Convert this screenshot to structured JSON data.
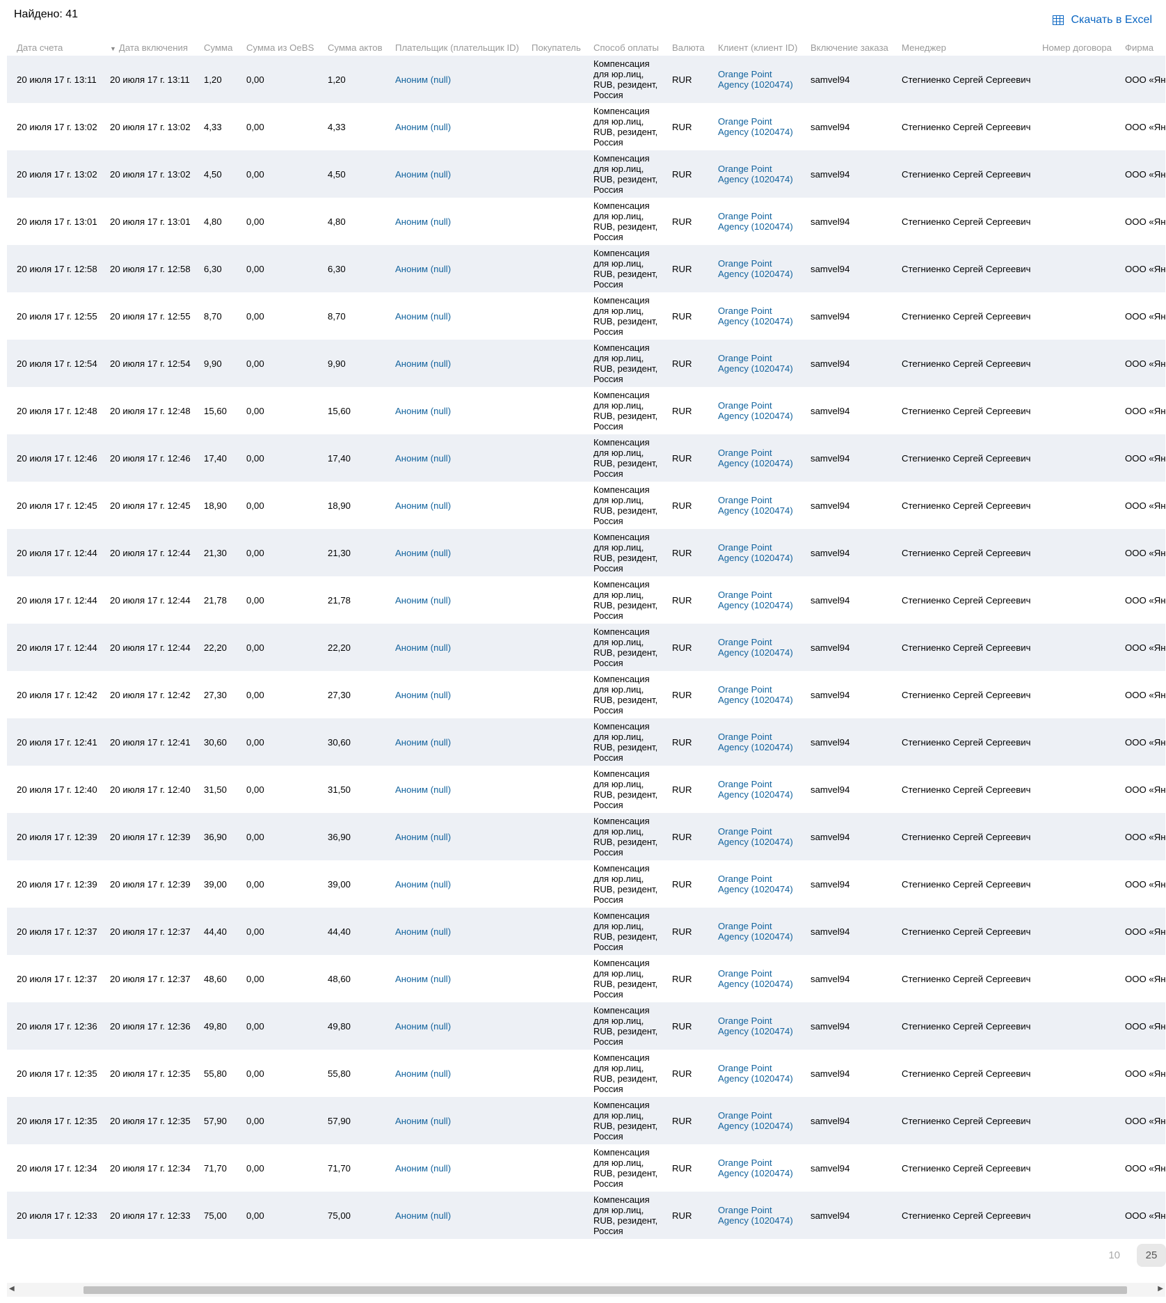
{
  "found_label": "Найдено: 41",
  "excel_label": "Скачать в Excel",
  "columns": [
    "Дата счета",
    "Дата включения",
    "Сумма",
    "Сумма из OeBS",
    "Сумма актов",
    "Плательщик (плательщик ID)",
    "Покупатель",
    "Способ оплаты",
    "Валюта",
    "Клиент (клиент ID)",
    "Включение заказа",
    "Менеджер",
    "Номер договора",
    "Фирма"
  ],
  "rows": [
    {
      "date": "20 июля 17 г. 13:11",
      "incl": "20 июля 17 г. 13:11",
      "sum": "1,20",
      "oebs": "0,00",
      "acts": "1,20",
      "payer": "Аноним (null)",
      "buyer": "",
      "method": "Компенсация для юр.лиц, RUB, резидент, Россия",
      "currency": "RUR",
      "client": "Orange Point Agency (1020474)",
      "order": "samvel94",
      "manager": "Стегниенко Сергей Сергеевич",
      "contract": "",
      "firm": "ООО «Ян"
    },
    {
      "date": "20 июля 17 г. 13:02",
      "incl": "20 июля 17 г. 13:02",
      "sum": "4,33",
      "oebs": "0,00",
      "acts": "4,33",
      "payer": "Аноним (null)",
      "buyer": "",
      "method": "Компенсация для юр.лиц, RUB, резидент, Россия",
      "currency": "RUR",
      "client": "Orange Point Agency (1020474)",
      "order": "samvel94",
      "manager": "Стегниенко Сергей Сергеевич",
      "contract": "",
      "firm": "ООО «Ян"
    },
    {
      "date": "20 июля 17 г. 13:02",
      "incl": "20 июля 17 г. 13:02",
      "sum": "4,50",
      "oebs": "0,00",
      "acts": "4,50",
      "payer": "Аноним (null)",
      "buyer": "",
      "method": "Компенсация для юр.лиц, RUB, резидент, Россия",
      "currency": "RUR",
      "client": "Orange Point Agency (1020474)",
      "order": "samvel94",
      "manager": "Стегниенко Сергей Сергеевич",
      "contract": "",
      "firm": "ООО «Ян"
    },
    {
      "date": "20 июля 17 г. 13:01",
      "incl": "20 июля 17 г. 13:01",
      "sum": "4,80",
      "oebs": "0,00",
      "acts": "4,80",
      "payer": "Аноним (null)",
      "buyer": "",
      "method": "Компенсация для юр.лиц, RUB, резидент, Россия",
      "currency": "RUR",
      "client": "Orange Point Agency (1020474)",
      "order": "samvel94",
      "manager": "Стегниенко Сергей Сергеевич",
      "contract": "",
      "firm": "ООО «Ян"
    },
    {
      "date": "20 июля 17 г. 12:58",
      "incl": "20 июля 17 г. 12:58",
      "sum": "6,30",
      "oebs": "0,00",
      "acts": "6,30",
      "payer": "Аноним (null)",
      "buyer": "",
      "method": "Компенсация для юр.лиц, RUB, резидент, Россия",
      "currency": "RUR",
      "client": "Orange Point Agency (1020474)",
      "order": "samvel94",
      "manager": "Стегниенко Сергей Сергеевич",
      "contract": "",
      "firm": "ООО «Ян"
    },
    {
      "date": "20 июля 17 г. 12:55",
      "incl": "20 июля 17 г. 12:55",
      "sum": "8,70",
      "oebs": "0,00",
      "acts": "8,70",
      "payer": "Аноним (null)",
      "buyer": "",
      "method": "Компенсация для юр.лиц, RUB, резидент, Россия",
      "currency": "RUR",
      "client": "Orange Point Agency (1020474)",
      "order": "samvel94",
      "manager": "Стегниенко Сергей Сергеевич",
      "contract": "",
      "firm": "ООО «Ян"
    },
    {
      "date": "20 июля 17 г. 12:54",
      "incl": "20 июля 17 г. 12:54",
      "sum": "9,90",
      "oebs": "0,00",
      "acts": "9,90",
      "payer": "Аноним (null)",
      "buyer": "",
      "method": "Компенсация для юр.лиц, RUB, резидент, Россия",
      "currency": "RUR",
      "client": "Orange Point Agency (1020474)",
      "order": "samvel94",
      "manager": "Стегниенко Сергей Сергеевич",
      "contract": "",
      "firm": "ООО «Ян"
    },
    {
      "date": "20 июля 17 г. 12:48",
      "incl": "20 июля 17 г. 12:48",
      "sum": "15,60",
      "oebs": "0,00",
      "acts": "15,60",
      "payer": "Аноним (null)",
      "buyer": "",
      "method": "Компенсация для юр.лиц, RUB, резидент, Россия",
      "currency": "RUR",
      "client": "Orange Point Agency (1020474)",
      "order": "samvel94",
      "manager": "Стегниенко Сергей Сергеевич",
      "contract": "",
      "firm": "ООО «Ян"
    },
    {
      "date": "20 июля 17 г. 12:46",
      "incl": "20 июля 17 г. 12:46",
      "sum": "17,40",
      "oebs": "0,00",
      "acts": "17,40",
      "payer": "Аноним (null)",
      "buyer": "",
      "method": "Компенсация для юр.лиц, RUB, резидент, Россия",
      "currency": "RUR",
      "client": "Orange Point Agency (1020474)",
      "order": "samvel94",
      "manager": "Стегниенко Сергей Сергеевич",
      "contract": "",
      "firm": "ООО «Ян"
    },
    {
      "date": "20 июля 17 г. 12:45",
      "incl": "20 июля 17 г. 12:45",
      "sum": "18,90",
      "oebs": "0,00",
      "acts": "18,90",
      "payer": "Аноним (null)",
      "buyer": "",
      "method": "Компенсация для юр.лиц, RUB, резидент, Россия",
      "currency": "RUR",
      "client": "Orange Point Agency (1020474)",
      "order": "samvel94",
      "manager": "Стегниенко Сергей Сергеевич",
      "contract": "",
      "firm": "ООО «Ян"
    },
    {
      "date": "20 июля 17 г. 12:44",
      "incl": "20 июля 17 г. 12:44",
      "sum": "21,30",
      "oebs": "0,00",
      "acts": "21,30",
      "payer": "Аноним (null)",
      "buyer": "",
      "method": "Компенсация для юр.лиц, RUB, резидент, Россия",
      "currency": "RUR",
      "client": "Orange Point Agency (1020474)",
      "order": "samvel94",
      "manager": "Стегниенко Сергей Сергеевич",
      "contract": "",
      "firm": "ООО «Ян"
    },
    {
      "date": "20 июля 17 г. 12:44",
      "incl": "20 июля 17 г. 12:44",
      "sum": "21,78",
      "oebs": "0,00",
      "acts": "21,78",
      "payer": "Аноним (null)",
      "buyer": "",
      "method": "Компенсация для юр.лиц, RUB, резидент, Россия",
      "currency": "RUR",
      "client": "Orange Point Agency (1020474)",
      "order": "samvel94",
      "manager": "Стегниенко Сергей Сергеевич",
      "contract": "",
      "firm": "ООО «Ян"
    },
    {
      "date": "20 июля 17 г. 12:44",
      "incl": "20 июля 17 г. 12:44",
      "sum": "22,20",
      "oebs": "0,00",
      "acts": "22,20",
      "payer": "Аноним (null)",
      "buyer": "",
      "method": "Компенсация для юр.лиц, RUB, резидент, Россия",
      "currency": "RUR",
      "client": "Orange Point Agency (1020474)",
      "order": "samvel94",
      "manager": "Стегниенко Сергей Сергеевич",
      "contract": "",
      "firm": "ООО «Ян"
    },
    {
      "date": "20 июля 17 г. 12:42",
      "incl": "20 июля 17 г. 12:42",
      "sum": "27,30",
      "oebs": "0,00",
      "acts": "27,30",
      "payer": "Аноним (null)",
      "buyer": "",
      "method": "Компенсация для юр.лиц, RUB, резидент, Россия",
      "currency": "RUR",
      "client": "Orange Point Agency (1020474)",
      "order": "samvel94",
      "manager": "Стегниенко Сергей Сергеевич",
      "contract": "",
      "firm": "ООО «Ян"
    },
    {
      "date": "20 июля 17 г. 12:41",
      "incl": "20 июля 17 г. 12:41",
      "sum": "30,60",
      "oebs": "0,00",
      "acts": "30,60",
      "payer": "Аноним (null)",
      "buyer": "",
      "method": "Компенсация для юр.лиц, RUB, резидент, Россия",
      "currency": "RUR",
      "client": "Orange Point Agency (1020474)",
      "order": "samvel94",
      "manager": "Стегниенко Сергей Сергеевич",
      "contract": "",
      "firm": "ООО «Ян"
    },
    {
      "date": "20 июля 17 г. 12:40",
      "incl": "20 июля 17 г. 12:40",
      "sum": "31,50",
      "oebs": "0,00",
      "acts": "31,50",
      "payer": "Аноним (null)",
      "buyer": "",
      "method": "Компенсация для юр.лиц, RUB, резидент, Россия",
      "currency": "RUR",
      "client": "Orange Point Agency (1020474)",
      "order": "samvel94",
      "manager": "Стегниенко Сергей Сергеевич",
      "contract": "",
      "firm": "ООО «Ян"
    },
    {
      "date": "20 июля 17 г. 12:39",
      "incl": "20 июля 17 г. 12:39",
      "sum": "36,90",
      "oebs": "0,00",
      "acts": "36,90",
      "payer": "Аноним (null)",
      "buyer": "",
      "method": "Компенсация для юр.лиц, RUB, резидент, Россия",
      "currency": "RUR",
      "client": "Orange Point Agency (1020474)",
      "order": "samvel94",
      "manager": "Стегниенко Сергей Сергеевич",
      "contract": "",
      "firm": "ООО «Ян"
    },
    {
      "date": "20 июля 17 г. 12:39",
      "incl": "20 июля 17 г. 12:39",
      "sum": "39,00",
      "oebs": "0,00",
      "acts": "39,00",
      "payer": "Аноним (null)",
      "buyer": "",
      "method": "Компенсация для юр.лиц, RUB, резидент, Россия",
      "currency": "RUR",
      "client": "Orange Point Agency (1020474)",
      "order": "samvel94",
      "manager": "Стегниенко Сергей Сергеевич",
      "contract": "",
      "firm": "ООО «Ян"
    },
    {
      "date": "20 июля 17 г. 12:37",
      "incl": "20 июля 17 г. 12:37",
      "sum": "44,40",
      "oebs": "0,00",
      "acts": "44,40",
      "payer": "Аноним (null)",
      "buyer": "",
      "method": "Компенсация для юр.лиц, RUB, резидент, Россия",
      "currency": "RUR",
      "client": "Orange Point Agency (1020474)",
      "order": "samvel94",
      "manager": "Стегниенко Сергей Сергеевич",
      "contract": "",
      "firm": "ООО «Ян"
    },
    {
      "date": "20 июля 17 г. 12:37",
      "incl": "20 июля 17 г. 12:37",
      "sum": "48,60",
      "oebs": "0,00",
      "acts": "48,60",
      "payer": "Аноним (null)",
      "buyer": "",
      "method": "Компенсация для юр.лиц, RUB, резидент, Россия",
      "currency": "RUR",
      "client": "Orange Point Agency (1020474)",
      "order": "samvel94",
      "manager": "Стегниенко Сергей Сергеевич",
      "contract": "",
      "firm": "ООО «Ян"
    },
    {
      "date": "20 июля 17 г. 12:36",
      "incl": "20 июля 17 г. 12:36",
      "sum": "49,80",
      "oebs": "0,00",
      "acts": "49,80",
      "payer": "Аноним (null)",
      "buyer": "",
      "method": "Компенсация для юр.лиц, RUB, резидент, Россия",
      "currency": "RUR",
      "client": "Orange Point Agency (1020474)",
      "order": "samvel94",
      "manager": "Стегниенко Сергей Сергеевич",
      "contract": "",
      "firm": "ООО «Ян"
    },
    {
      "date": "20 июля 17 г. 12:35",
      "incl": "20 июля 17 г. 12:35",
      "sum": "55,80",
      "oebs": "0,00",
      "acts": "55,80",
      "payer": "Аноним (null)",
      "buyer": "",
      "method": "Компенсация для юр.лиц, RUB, резидент, Россия",
      "currency": "RUR",
      "client": "Orange Point Agency (1020474)",
      "order": "samvel94",
      "manager": "Стегниенко Сергей Сергеевич",
      "contract": "",
      "firm": "ООО «Ян"
    },
    {
      "date": "20 июля 17 г. 12:35",
      "incl": "20 июля 17 г. 12:35",
      "sum": "57,90",
      "oebs": "0,00",
      "acts": "57,90",
      "payer": "Аноним (null)",
      "buyer": "",
      "method": "Компенсация для юр.лиц, RUB, резидент, Россия",
      "currency": "RUR",
      "client": "Orange Point Agency (1020474)",
      "order": "samvel94",
      "manager": "Стегниенко Сергей Сергеевич",
      "contract": "",
      "firm": "ООО «Ян"
    },
    {
      "date": "20 июля 17 г. 12:34",
      "incl": "20 июля 17 г. 12:34",
      "sum": "71,70",
      "oebs": "0,00",
      "acts": "71,70",
      "payer": "Аноним (null)",
      "buyer": "",
      "method": "Компенсация для юр.лиц, RUB, резидент, Россия",
      "currency": "RUR",
      "client": "Orange Point Agency (1020474)",
      "order": "samvel94",
      "manager": "Стегниенко Сергей Сергеевич",
      "contract": "",
      "firm": "ООО «Ян"
    },
    {
      "date": "20 июля 17 г. 12:33",
      "incl": "20 июля 17 г. 12:33",
      "sum": "75,00",
      "oebs": "0,00",
      "acts": "75,00",
      "payer": "Аноним (null)",
      "buyer": "",
      "method": "Компенсация для юр.лиц, RUB, резидент, Россия",
      "currency": "RUR",
      "client": "Orange Point Agency (1020474)",
      "order": "samvel94",
      "manager": "Стегниенко Сергей Сергеевич",
      "contract": "",
      "firm": "ООО «Ян"
    }
  ],
  "pager": {
    "sizes": [
      "10",
      "25"
    ],
    "active": "25"
  },
  "icons": {
    "excel": "table-grid-icon",
    "sort": "sort-down-icon",
    "scroll_left": "arrow-left-icon",
    "scroll_right": "arrow-right-icon"
  },
  "colors": {
    "link": "#14649e",
    "excel_link": "#0b66c2",
    "row_stripe": "#edf0f5",
    "header_text": "#9b9b9b"
  }
}
